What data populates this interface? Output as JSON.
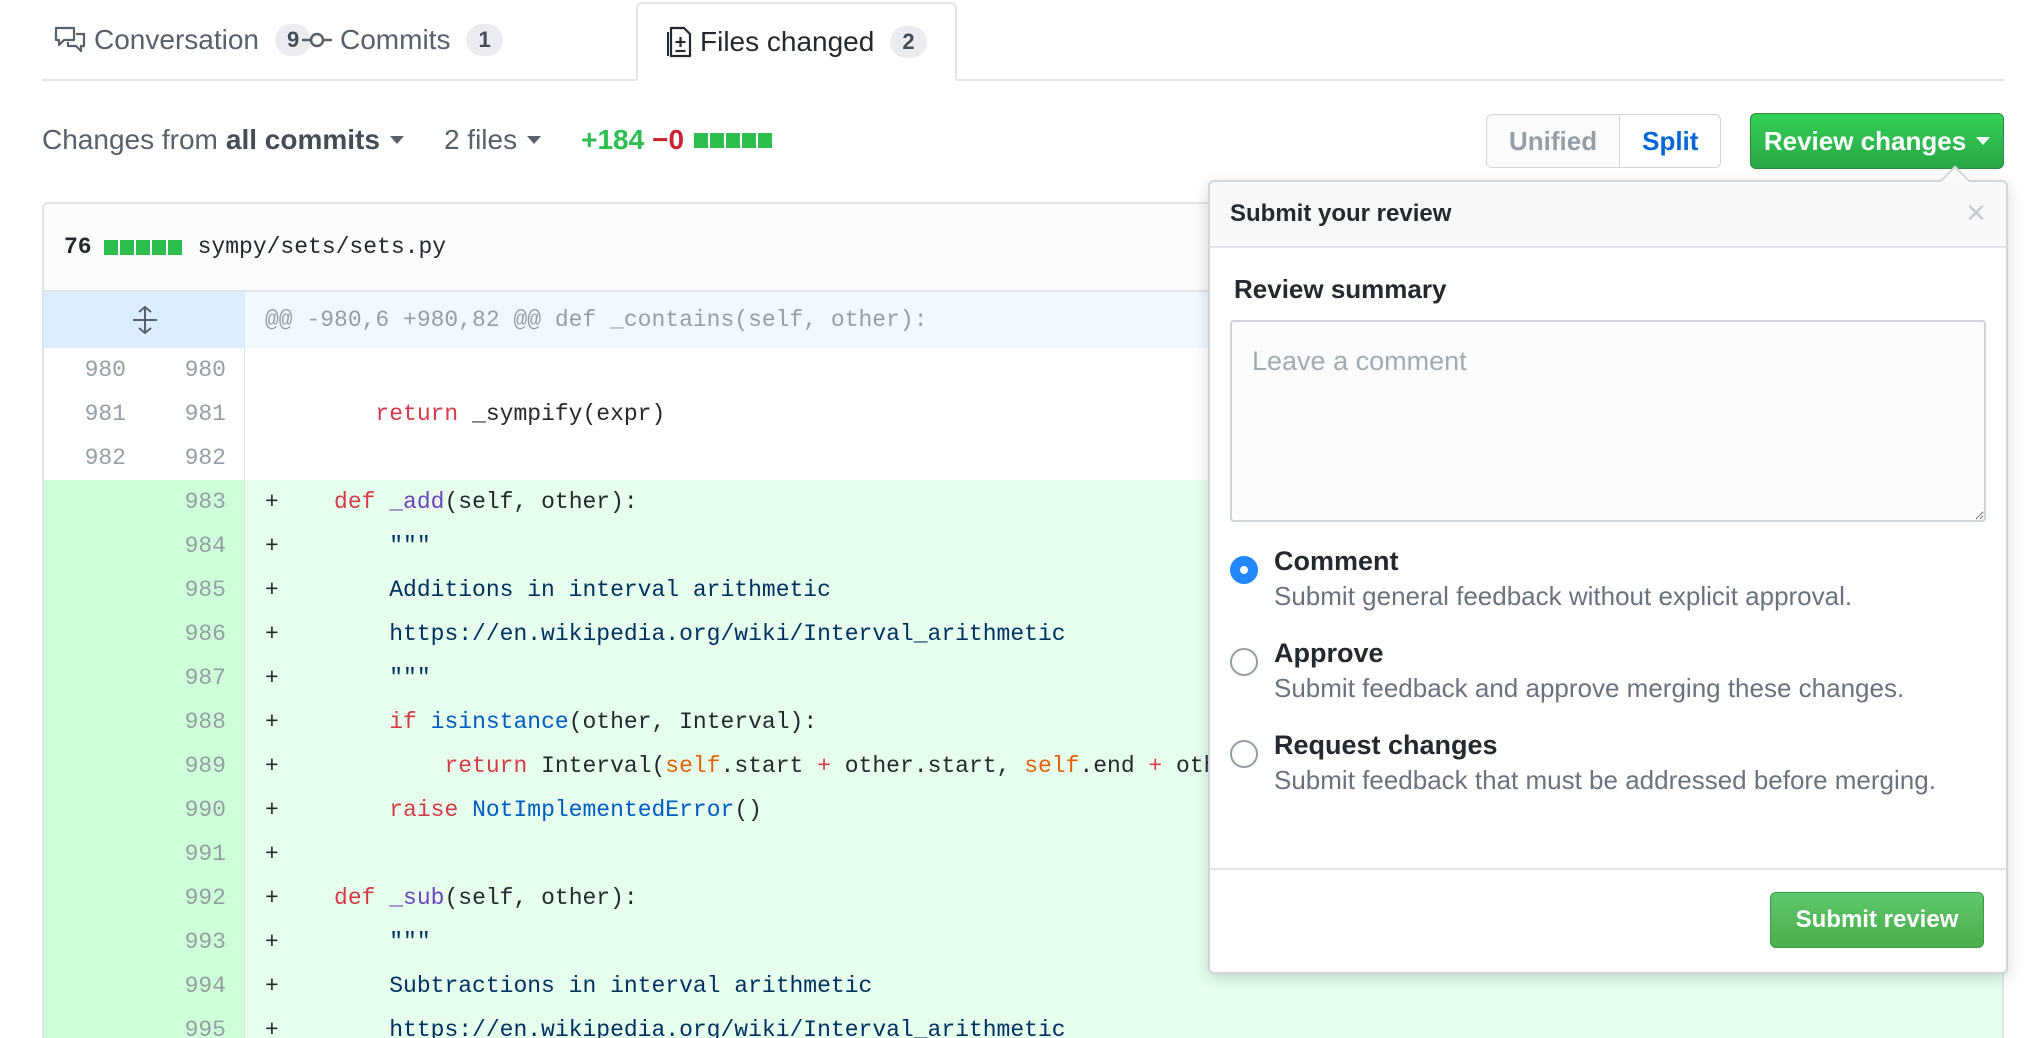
{
  "tabs": [
    {
      "label": "Conversation",
      "count": "9",
      "icon": "comment-discussion-icon"
    },
    {
      "label": "Commits",
      "count": "1",
      "icon": "git-commit-icon"
    },
    {
      "label": "Files changed",
      "count": "2",
      "icon": "file-diff-icon"
    }
  ],
  "toolbar": {
    "changes_prefix": "Changes from",
    "changes_value": "all commits",
    "files": "2 files",
    "additions": "+184",
    "deletions": "−0",
    "view_unified": "Unified",
    "view_split": "Split",
    "review_button": "Review changes"
  },
  "file": {
    "changes_count": "76",
    "path": "sympy/sets/sets.py",
    "hunk_header": "@@ -980,6 +980,82 @@ def _contains(self, other):"
  },
  "diff_lines": [
    {
      "old": "980",
      "new": "980",
      "type": "ctx",
      "code": ""
    },
    {
      "old": "981",
      "new": "981",
      "type": "ctx",
      "code": "        return _sympify(expr)"
    },
    {
      "old": "982",
      "new": "982",
      "type": "ctx",
      "code": ""
    },
    {
      "old": "",
      "new": "983",
      "type": "add",
      "code": "+    def _add(self, other):"
    },
    {
      "old": "",
      "new": "984",
      "type": "add",
      "code": "+        \"\"\""
    },
    {
      "old": "",
      "new": "985",
      "type": "add",
      "code": "+        Additions in interval arithmetic"
    },
    {
      "old": "",
      "new": "986",
      "type": "add",
      "code": "+        https://en.wikipedia.org/wiki/Interval_arithmetic"
    },
    {
      "old": "",
      "new": "987",
      "type": "add",
      "code": "+        \"\"\""
    },
    {
      "old": "",
      "new": "988",
      "type": "add",
      "code": "+        if isinstance(other, Interval):"
    },
    {
      "old": "",
      "new": "989",
      "type": "add",
      "code": "+            return Interval(self.start + other.start, self.end + other"
    },
    {
      "old": "",
      "new": "990",
      "type": "add",
      "code": "+        raise NotImplementedError()"
    },
    {
      "old": "",
      "new": "991",
      "type": "add",
      "code": "+"
    },
    {
      "old": "",
      "new": "992",
      "type": "add",
      "code": "+    def _sub(self, other):"
    },
    {
      "old": "",
      "new": "993",
      "type": "add",
      "code": "+        \"\"\""
    },
    {
      "old": "",
      "new": "994",
      "type": "add",
      "code": "+        Subtractions in interval arithmetic"
    },
    {
      "old": "",
      "new": "995",
      "type": "add",
      "code": "+        https://en.wikipedia.org/wiki/Interval_arithmetic"
    }
  ],
  "review_popup": {
    "title": "Submit your review",
    "close": "×",
    "summary_label": "Review summary",
    "comment_placeholder": "Leave a comment",
    "comment_value": "",
    "options": [
      {
        "title": "Comment",
        "description": "Submit general feedback without explicit approval.",
        "selected": true
      },
      {
        "title": "Approve",
        "description": "Submit feedback and approve merging these changes.",
        "selected": false
      },
      {
        "title": "Request changes",
        "description": "Submit feedback that must be addressed before merging.",
        "selected": false
      }
    ],
    "submit_button": "Submit review"
  },
  "colors": {
    "addition": "#2cbe4e",
    "deletion": "#cb2431",
    "primary_button": "#28a745",
    "link": "#0366d6",
    "added_line_bg": "#e6ffed",
    "hunk_bg": "#f1f8ff"
  }
}
